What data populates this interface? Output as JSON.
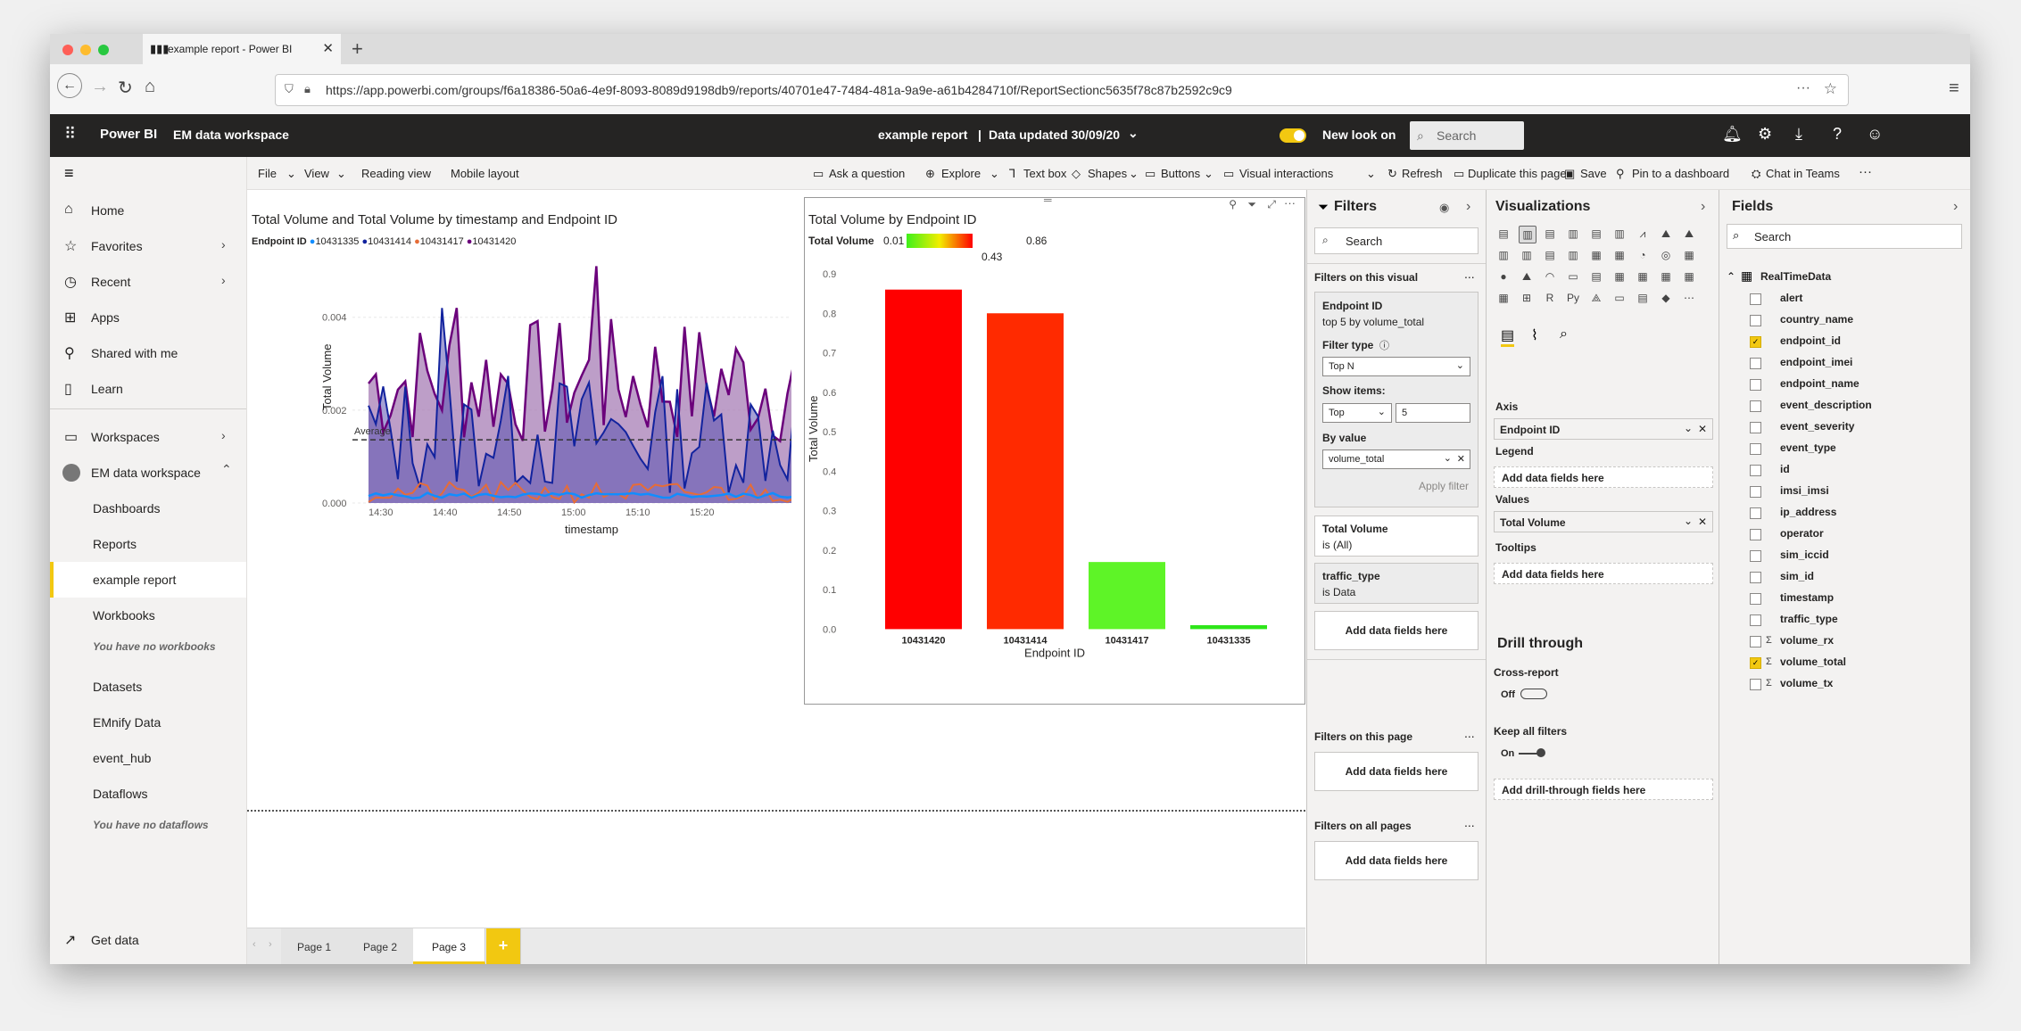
{
  "browser": {
    "tab_title": "example report - Power BI",
    "url": "https://app.powerbi.com/groups/f6a18386-50a6-4e9f-8093-8089d9198db9/reports/40701e47-7484-481a-9a9e-a61b4284710f/ReportSectionc5635f78c87b2592c9c9"
  },
  "header": {
    "app": "Power BI",
    "workspace": "EM data workspace",
    "report_title": "example report",
    "separator": "|",
    "data_updated": "Data updated 30/09/20",
    "new_look": "New look on",
    "search_placeholder": "Search"
  },
  "nav": {
    "home": "Home",
    "favorites": "Favorites",
    "recent": "Recent",
    "apps": "Apps",
    "shared": "Shared with me",
    "learn": "Learn",
    "workspaces": "Workspaces",
    "workspace": "EM data workspace",
    "dashboards": "Dashboards",
    "reports": "Reports",
    "example_report": "example report",
    "workbooks": "Workbooks",
    "no_workbooks": "You have no workbooks",
    "datasets": "Datasets",
    "emnify": "EMnify Data",
    "event_hub": "event_hub",
    "dataflows": "Dataflows",
    "no_dataflows": "You have no dataflows",
    "get_data": "Get data"
  },
  "toolbar": {
    "file": "File",
    "view": "View",
    "reading_view": "Reading view",
    "mobile_layout": "Mobile layout",
    "ask": "Ask a question",
    "explore": "Explore",
    "textbox": "Text box",
    "shapes": "Shapes",
    "buttons": "Buttons",
    "visual_interactions": "Visual interactions",
    "refresh": "Refresh",
    "duplicate": "Duplicate this page",
    "save": "Save",
    "pin": "Pin to a dashboard",
    "chat": "Chat in Teams",
    "more": "···"
  },
  "visual1": {
    "legend_title": "Endpoint ID",
    "average_label": "Average",
    "xlabel": "timestamp",
    "ylabel": "Total Volume",
    "y_ticks": [
      "0.000",
      "0.002",
      "0.004"
    ],
    "x_ticks": [
      "14:30",
      "14:40",
      "14:50",
      "15:00",
      "15:10",
      "15:20"
    ]
  },
  "visual2": {
    "title": "Total Volume by Endpoint ID",
    "legend_label": "Total Volume",
    "grad_min": "0.01",
    "grad_mid": "0.43",
    "grad_max": "0.86",
    "xlabel": "Endpoint ID",
    "ylabel": "Total Volume"
  },
  "chart_data": [
    {
      "type": "area",
      "title": "Total Volume and Total Volume by timestamp and Endpoint ID",
      "xlabel": "timestamp",
      "ylabel": "Total Volume",
      "legend": "top-left",
      "ylim": [
        0,
        0.0053
      ],
      "series": [
        {
          "name": "10431335",
          "color": "#118dff"
        },
        {
          "name": "10431414",
          "color": "#12239e"
        },
        {
          "name": "10431417",
          "color": "#e66c37"
        },
        {
          "name": "10431420",
          "color": "#6b007b"
        }
      ],
      "x_ticks": [
        "14:30",
        "14:40",
        "14:50",
        "15:00",
        "15:10",
        "15:20"
      ],
      "y_ticks": [
        "0.000",
        "0.002",
        "0.004"
      ],
      "average_line": 0.00136,
      "average_label": "Average"
    },
    {
      "type": "bar",
      "title": "Total Volume by Endpoint ID",
      "categories": [
        "10431420",
        "10431414",
        "10431417",
        "10431335"
      ],
      "values": [
        0.86,
        0.8,
        0.17,
        0.01
      ],
      "colors": [
        "#ff0000",
        "#ff2a00",
        "#5ef427",
        "#2ee61a"
      ],
      "xlabel": "Endpoint ID",
      "ylabel": "Total Volume",
      "ylim": [
        0,
        0.9
      ],
      "y_ticks": [
        "0.0",
        "0.1",
        "0.2",
        "0.3",
        "0.4",
        "0.5",
        "0.6",
        "0.7",
        "0.8",
        "0.9"
      ],
      "color_scale": {
        "label": "Total Volume",
        "min": "0.01",
        "mid": "0.43",
        "max": "0.86"
      }
    }
  ],
  "filters": {
    "title": "Filters",
    "search": "Search",
    "on_visual": "Filters on this visual",
    "card_title": "Endpoint ID",
    "card_sub": "top 5 by volume_total",
    "filter_type_label": "Filter type",
    "filter_type": "Top N",
    "show_items_label": "Show items:",
    "show_items_dir": "Top",
    "show_items_n": "5",
    "by_value_label": "By value",
    "by_value": "volume_total",
    "apply": "Apply filter",
    "total_volume": "Total Volume",
    "is_all": "is (All)",
    "traffic_type": "traffic_type",
    "is_data": "is Data",
    "add_fields": "Add data fields here",
    "on_page": "Filters on this page",
    "on_all": "Filters on all pages",
    "more": "..."
  },
  "viz": {
    "title": "Visualizations",
    "axis": "Axis",
    "axis_field": "Endpoint ID",
    "legend": "Legend",
    "add_fields": "Add data fields here",
    "values": "Values",
    "values_field": "Total Volume",
    "tooltips": "Tooltips",
    "drill": "Drill through",
    "cross": "Cross-report",
    "off": "Off",
    "keep": "Keep all filters",
    "on": "On",
    "add_drill": "Add drill-through fields here"
  },
  "fields": {
    "title": "Fields",
    "search": "Search",
    "table": "RealTimeData",
    "items": [
      {
        "name": "alert",
        "checked": false,
        "sigma": false
      },
      {
        "name": "country_name",
        "checked": false,
        "sigma": false
      },
      {
        "name": "endpoint_id",
        "checked": true,
        "sigma": false
      },
      {
        "name": "endpoint_imei",
        "checked": false,
        "sigma": false
      },
      {
        "name": "endpoint_name",
        "checked": false,
        "sigma": false
      },
      {
        "name": "event_description",
        "checked": false,
        "sigma": false
      },
      {
        "name": "event_severity",
        "checked": false,
        "sigma": false
      },
      {
        "name": "event_type",
        "checked": false,
        "sigma": false
      },
      {
        "name": "id",
        "checked": false,
        "sigma": false
      },
      {
        "name": "imsi_imsi",
        "checked": false,
        "sigma": false
      },
      {
        "name": "ip_address",
        "checked": false,
        "sigma": false
      },
      {
        "name": "operator",
        "checked": false,
        "sigma": false
      },
      {
        "name": "sim_iccid",
        "checked": false,
        "sigma": false
      },
      {
        "name": "sim_id",
        "checked": false,
        "sigma": false
      },
      {
        "name": "timestamp",
        "checked": false,
        "sigma": false
      },
      {
        "name": "traffic_type",
        "checked": false,
        "sigma": false
      },
      {
        "name": "volume_rx",
        "checked": false,
        "sigma": true
      },
      {
        "name": "volume_total",
        "checked": true,
        "sigma": true
      },
      {
        "name": "volume_tx",
        "checked": false,
        "sigma": true
      }
    ]
  },
  "pages": [
    "Page 1",
    "Page 2",
    "Page 3"
  ],
  "add_page": "+",
  "colors": {
    "accent": "#f2c811",
    "header": "#252423"
  }
}
